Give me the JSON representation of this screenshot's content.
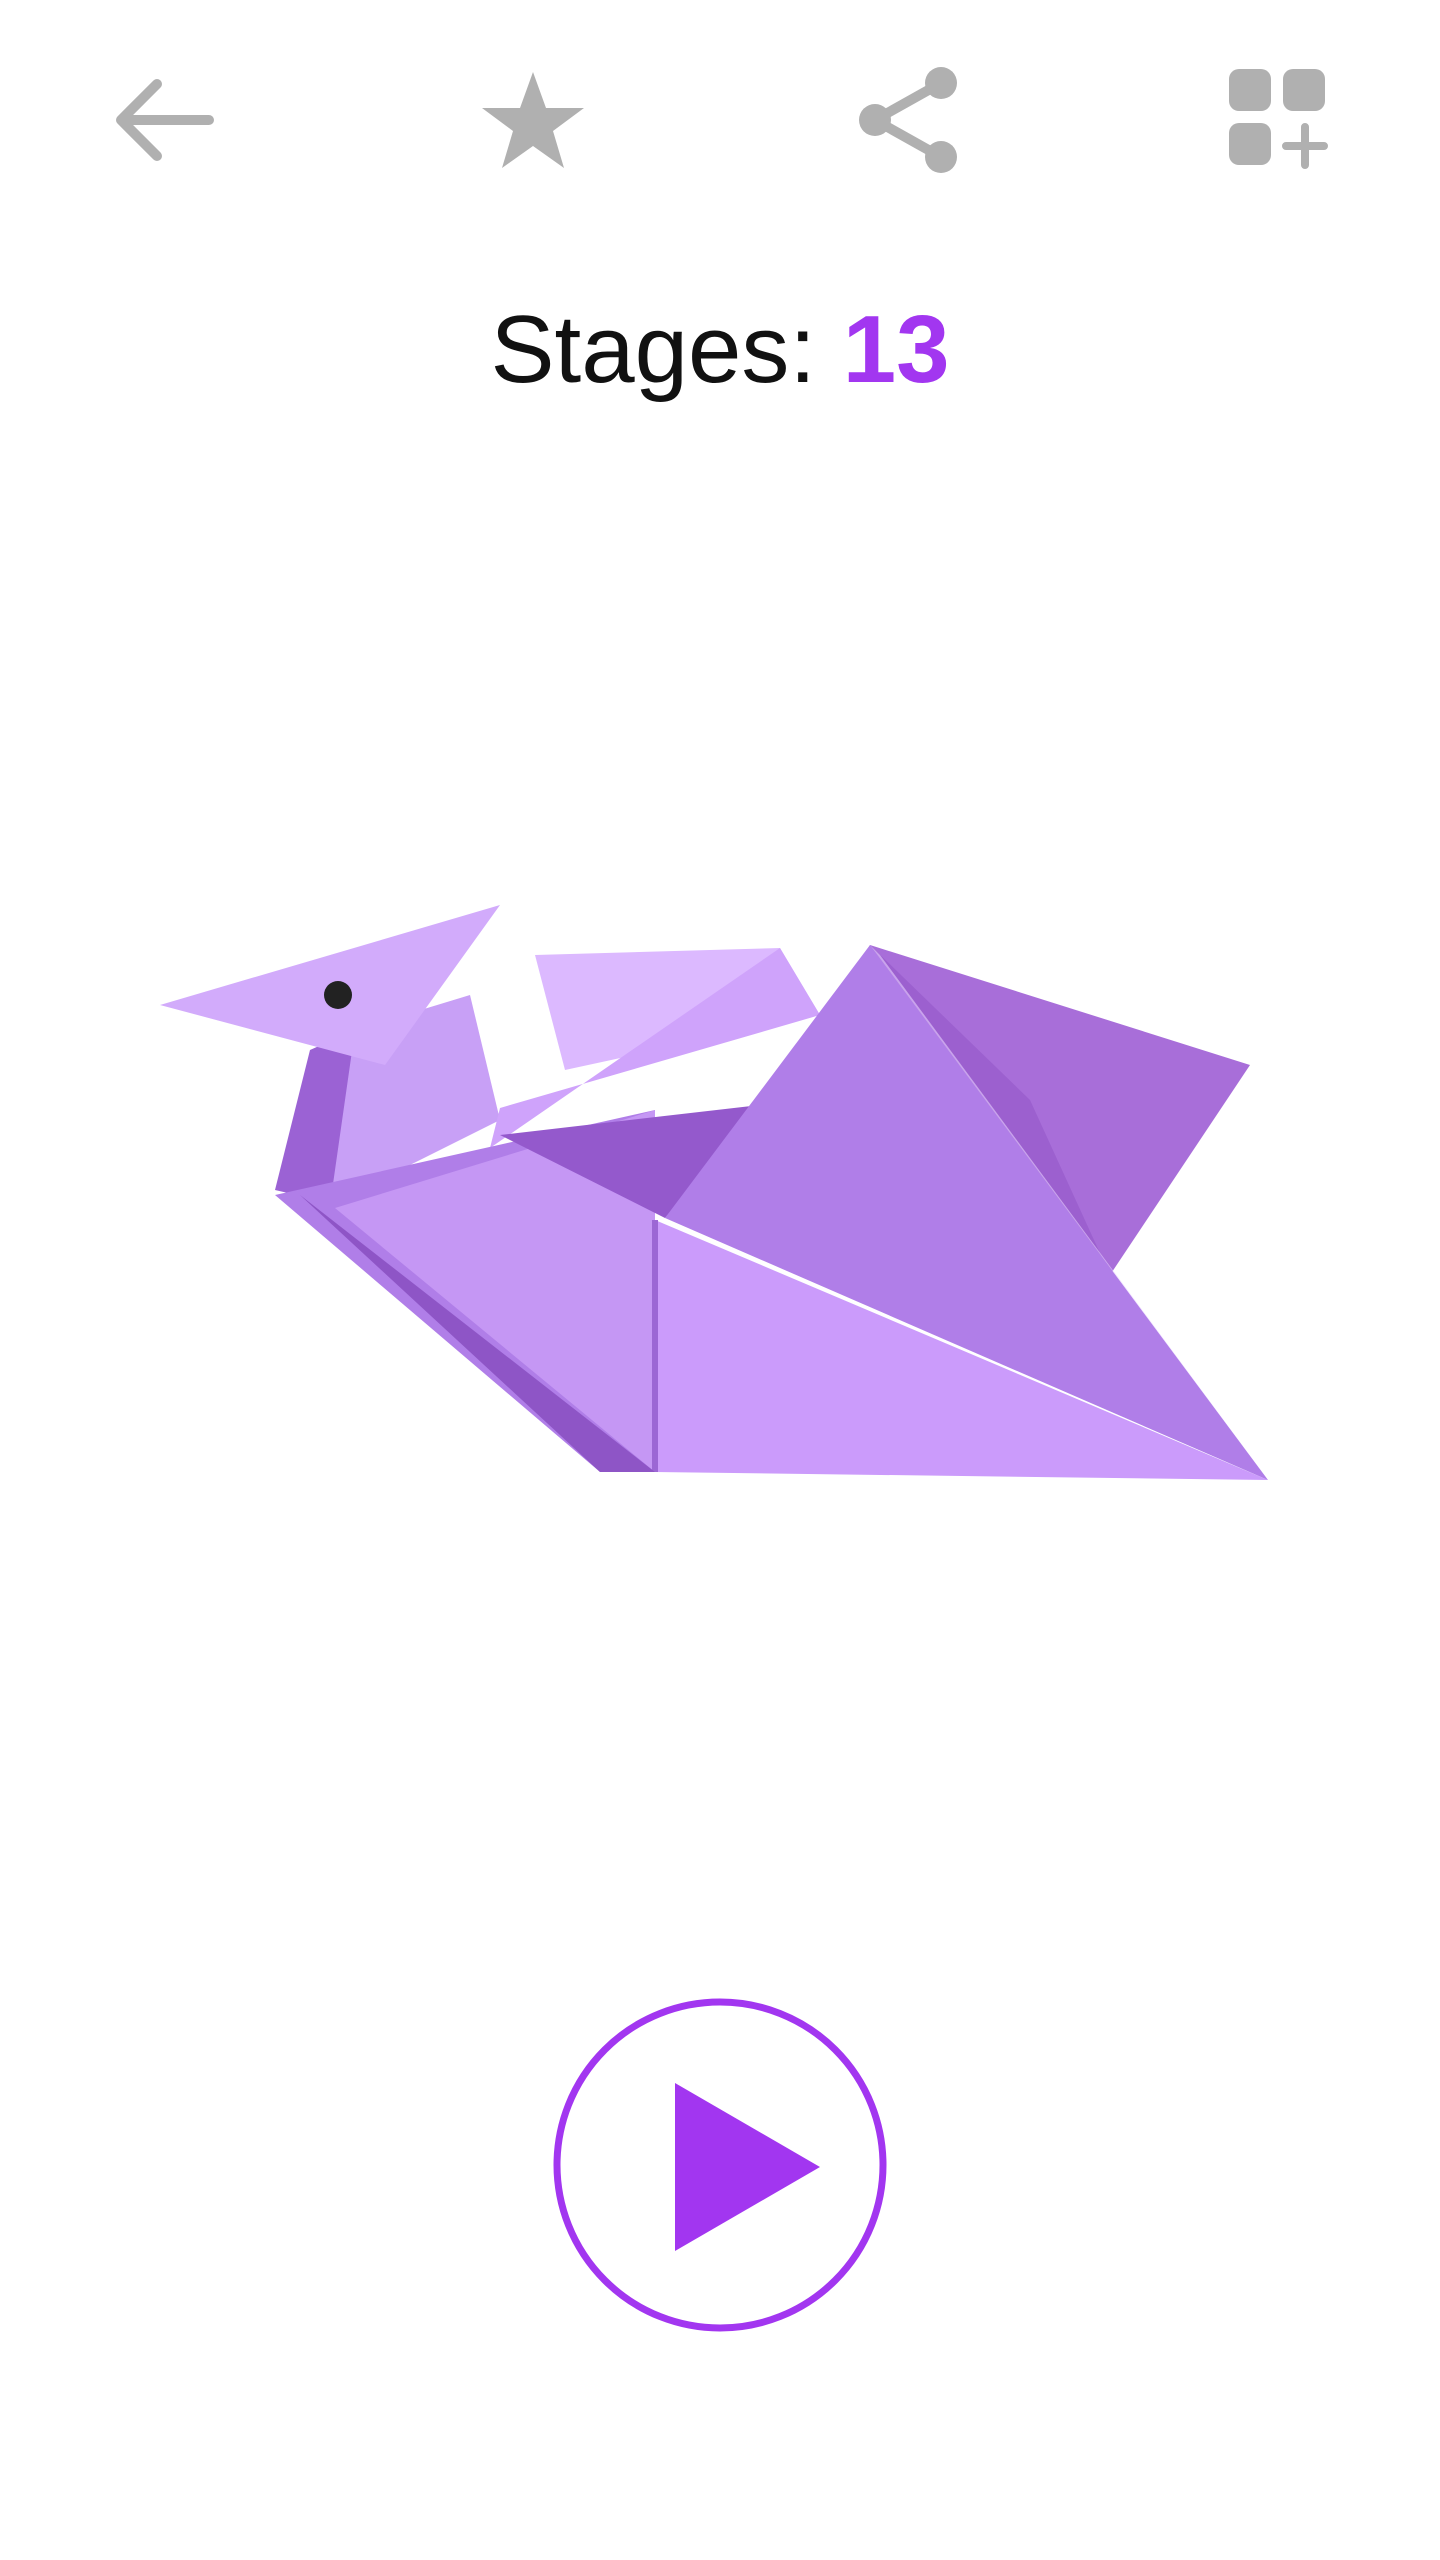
{
  "toolbar": {
    "icons": {
      "back": "arrow-back-icon",
      "favorite": "star-icon",
      "share": "share-icon",
      "add": "add-to-collection-icon"
    },
    "icon_color": "#b0b0b0"
  },
  "stages": {
    "label": "Stages:",
    "count": "13"
  },
  "model": {
    "icon": "origami-swan-icon"
  },
  "play": {
    "icon": "play-icon"
  },
  "colors": {
    "accent": "#a236f0",
    "paper_light": "#d9b7ff",
    "paper_mid": "#c592f3",
    "paper_dark": "#a86ed9"
  }
}
